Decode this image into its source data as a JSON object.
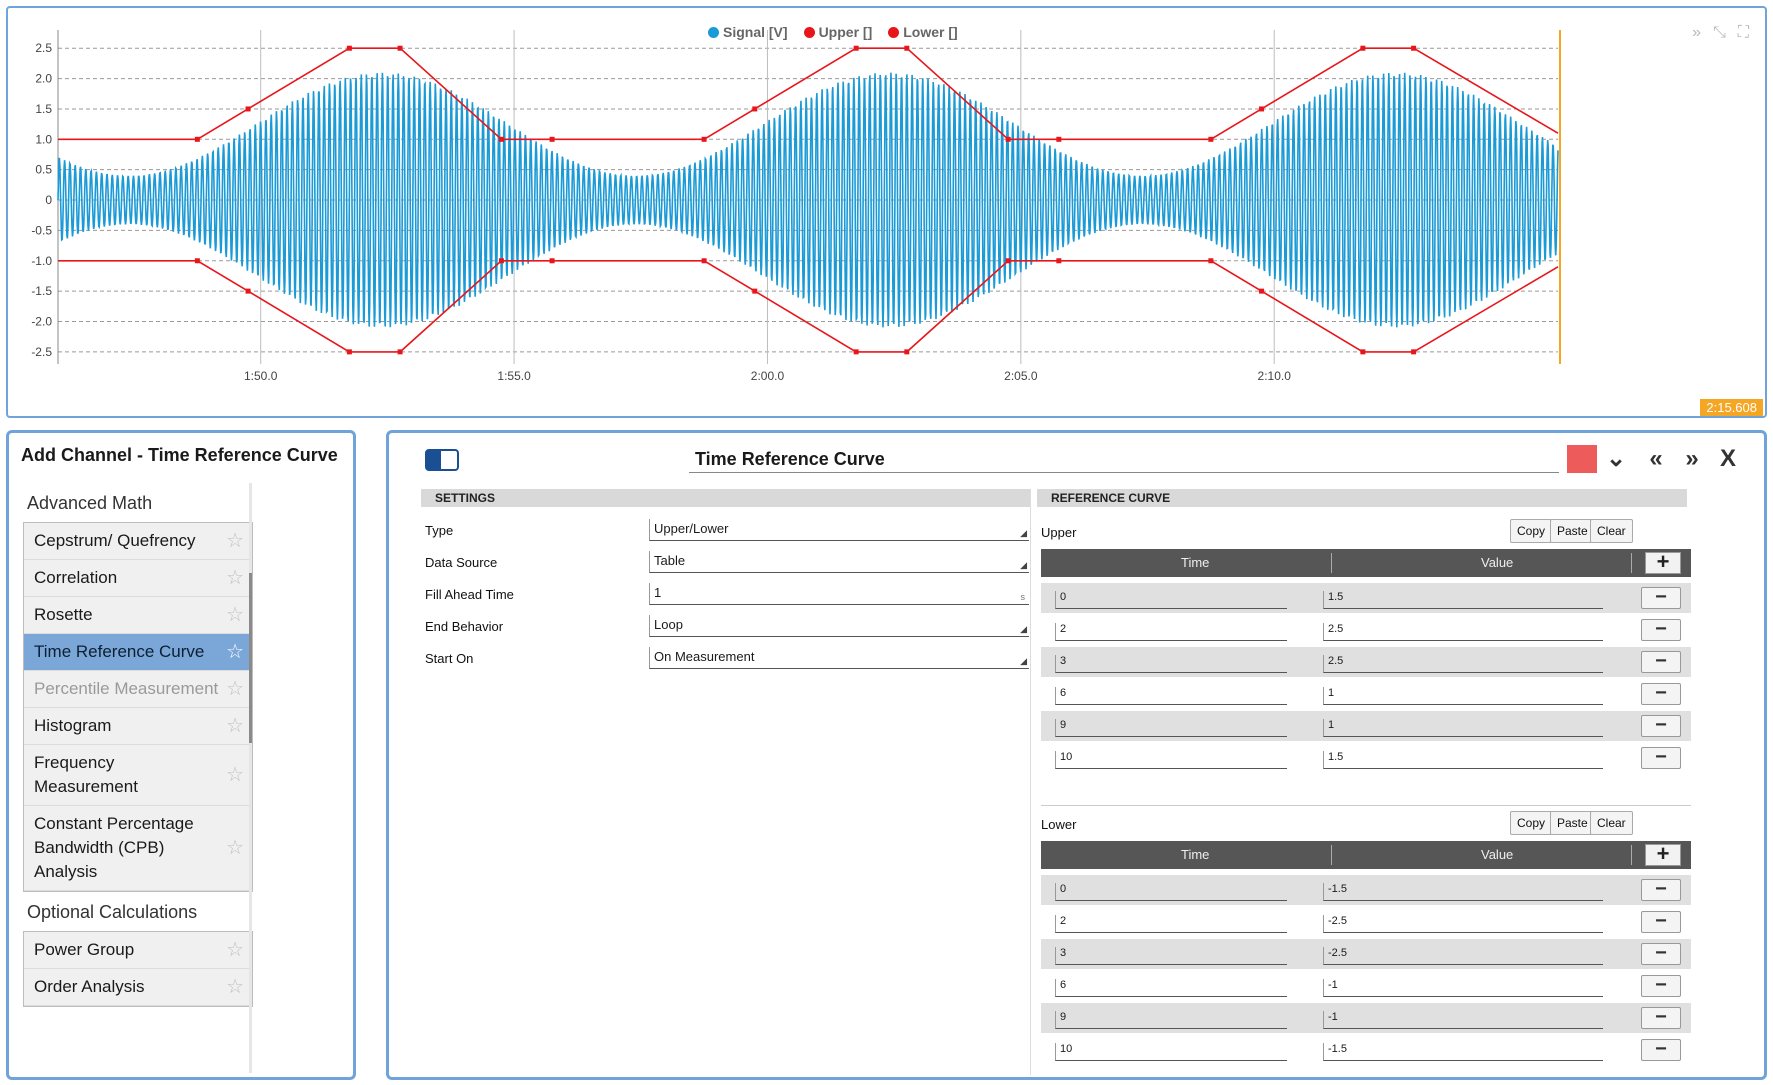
{
  "chart": {
    "legend": [
      {
        "label": "Signal [V]",
        "color": "#1a9ad6"
      },
      {
        "label": "Upper []",
        "color": "#e8161b"
      },
      {
        "label": "Lower []",
        "color": "#e8161b"
      }
    ],
    "tools": {
      "next_icon": "»",
      "zoom_icon": "⤡",
      "fullscreen_icon": "⛶"
    },
    "current_time": "2:15.608"
  },
  "chart_data": {
    "type": "line",
    "title": "",
    "xlabel": "",
    "ylabel": "",
    "x_ticks": [
      "1:50.0",
      "1:55.0",
      "2:00.0",
      "2:05.0",
      "2:10.0"
    ],
    "x_tick_seconds": [
      110,
      115,
      120,
      125,
      130
    ],
    "xlim_seconds": [
      106.0,
      135.6
    ],
    "ylim": [
      -2.7,
      2.8
    ],
    "y_ticks": [
      "2.5",
      "2.0",
      "1.5",
      "1.0",
      "0.5",
      "0",
      "-0.5",
      "-1.0",
      "-1.5",
      "-2.0",
      "-2.5"
    ],
    "y_tick_values": [
      2.5,
      2.0,
      1.5,
      1.0,
      0.5,
      0,
      -0.5,
      -1.0,
      -1.5,
      -2.0,
      -2.5
    ],
    "grid": true,
    "legend_position": "top-center",
    "series": [
      {
        "name": "Upper []",
        "color": "#e8161b",
        "x_seconds": [
          106.0,
          108.75,
          109.75,
          111.75,
          112.75,
          114.75,
          115.75,
          118.75,
          119.75,
          121.75,
          122.75,
          124.75,
          125.75,
          128.75,
          129.75,
          131.75,
          132.75,
          135.6
        ],
        "values": [
          1,
          1,
          1.5,
          2.5,
          2.5,
          1,
          1,
          1,
          1.5,
          2.5,
          2.5,
          1,
          1,
          1,
          1.5,
          2.5,
          2.5,
          1.1
        ]
      },
      {
        "name": "Lower []",
        "color": "#e8161b",
        "x_seconds": [
          106.0,
          108.75,
          109.75,
          111.75,
          112.75,
          114.75,
          115.75,
          118.75,
          119.75,
          121.75,
          122.75,
          124.75,
          125.75,
          128.75,
          129.75,
          131.75,
          132.75,
          135.6
        ],
        "values": [
          -1,
          -1,
          -1.5,
          -2.5,
          -2.5,
          -1,
          -1,
          -1,
          -1.5,
          -2.5,
          -2.5,
          -1,
          -1,
          -1,
          -1.5,
          -2.5,
          -2.5,
          -1.1
        ]
      },
      {
        "name": "Signal [V]",
        "color": "#1a9ad6",
        "description_envelope": {
          "min_amplitude": 0.4,
          "max_amplitude": 2.1,
          "period_seconds": 10,
          "peak_seconds": [
            112.4,
            122.4,
            132.4
          ]
        }
      }
    ]
  },
  "left_panel": {
    "title": "Add Channel - Time Reference Curve",
    "categories": [
      {
        "name": "Advanced Math",
        "items": [
          {
            "label": "Cepstrum/ Quefrency",
            "state": "normal"
          },
          {
            "label": "Correlation",
            "state": "normal"
          },
          {
            "label": "Rosette",
            "state": "normal"
          },
          {
            "label": "Time Reference Curve",
            "state": "selected"
          },
          {
            "label": "Percentile Measurement",
            "state": "disabled"
          },
          {
            "label": "Histogram",
            "state": "normal"
          },
          {
            "label": "Frequency Measurement",
            "state": "normal"
          },
          {
            "label": "Constant Percentage Bandwidth (CPB) Analysis",
            "state": "normal"
          }
        ]
      },
      {
        "name": "Optional Calculations",
        "items": [
          {
            "label": "Power Group",
            "state": "normal"
          },
          {
            "label": "Order Analysis",
            "state": "normal"
          }
        ]
      }
    ],
    "star_icon": "☆"
  },
  "right_panel": {
    "title": "Time Reference Curve",
    "color": "#ee5b5b",
    "icons": {
      "dropdown": "⌄",
      "prev": "«",
      "next": "»",
      "close": "X"
    },
    "settings": {
      "header": "SETTINGS",
      "rows": [
        {
          "label": "Type",
          "value": "Upper/Lower",
          "kind": "select"
        },
        {
          "label": "Data Source",
          "value": "Table",
          "kind": "select"
        },
        {
          "label": "Fill Ahead Time",
          "value": "1",
          "kind": "number",
          "unit": "s"
        },
        {
          "label": "End Behavior",
          "value": "Loop",
          "kind": "select"
        },
        {
          "label": "Start On",
          "value": "On Measurement",
          "kind": "select"
        }
      ]
    },
    "reference_curve": {
      "header": "REFERENCE CURVE",
      "buttons": {
        "copy": "Copy",
        "paste": "Paste",
        "clear": "Clear"
      },
      "columns": {
        "time": "Time",
        "value": "Value"
      },
      "add_icon": "+",
      "remove_icon": "−",
      "upper": {
        "label": "Upper",
        "rows": [
          {
            "time": "0",
            "value": "1.5"
          },
          {
            "time": "2",
            "value": "2.5"
          },
          {
            "time": "3",
            "value": "2.5"
          },
          {
            "time": "6",
            "value": "1"
          },
          {
            "time": "9",
            "value": "1"
          },
          {
            "time": "10",
            "value": "1.5"
          }
        ]
      },
      "lower": {
        "label": "Lower",
        "rows": [
          {
            "time": "0",
            "value": "-1.5"
          },
          {
            "time": "2",
            "value": "-2.5"
          },
          {
            "time": "3",
            "value": "-2.5"
          },
          {
            "time": "6",
            "value": "-1"
          },
          {
            "time": "9",
            "value": "-1"
          },
          {
            "time": "10",
            "value": "-1.5"
          }
        ]
      }
    }
  }
}
